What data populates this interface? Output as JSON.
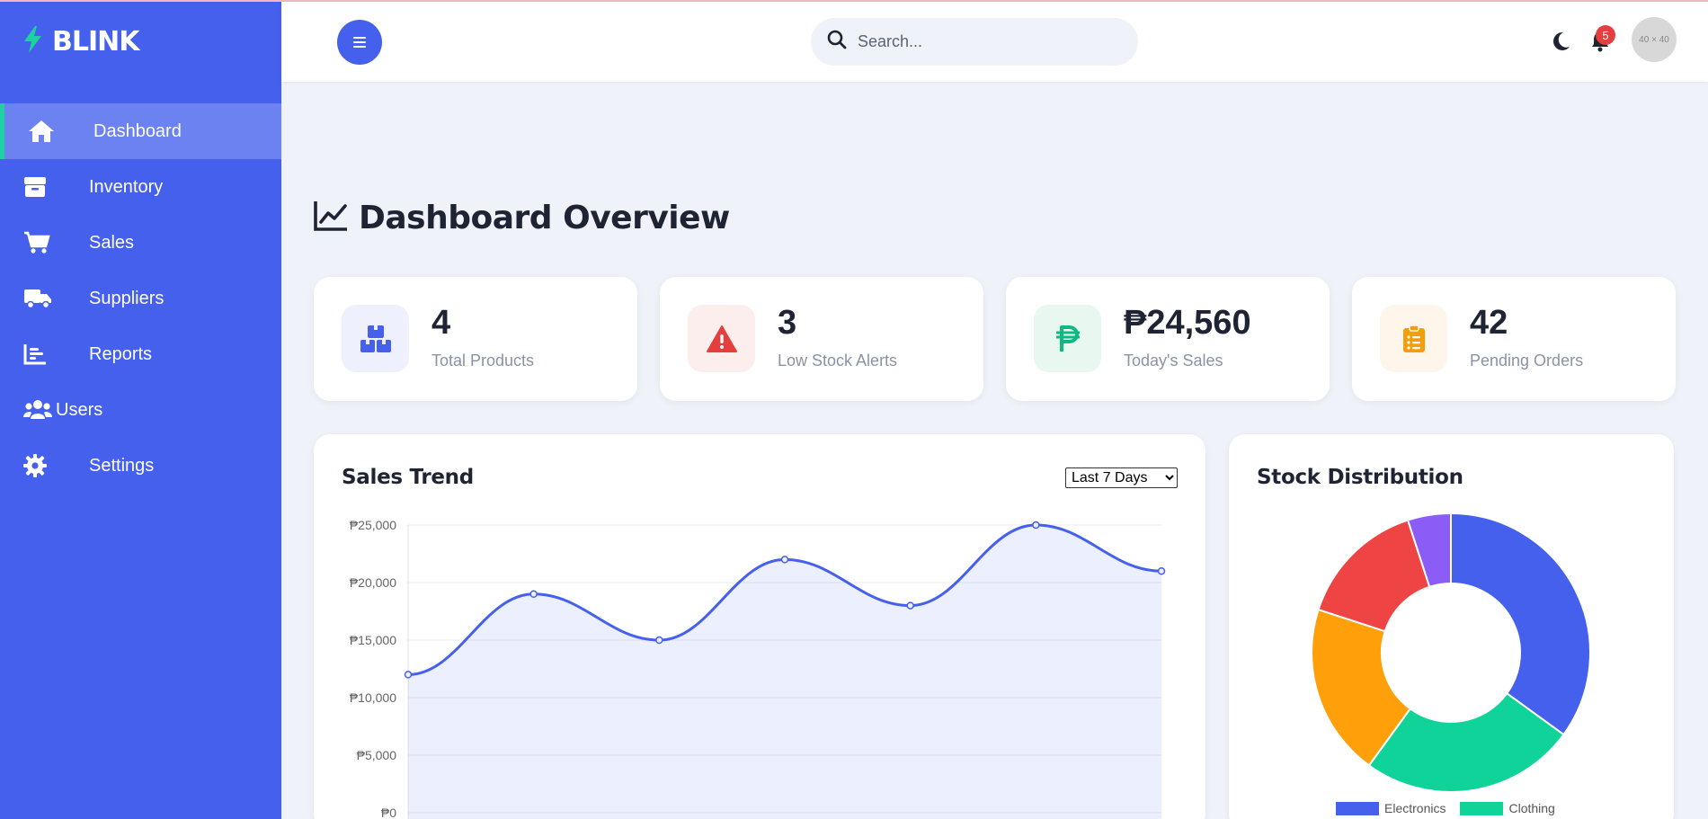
{
  "brand": {
    "name": "BLINK"
  },
  "sidebar": {
    "items": [
      {
        "label": "Dashboard",
        "icon": "home-icon",
        "active": true
      },
      {
        "label": "Inventory",
        "icon": "box-icon"
      },
      {
        "label": "Sales",
        "icon": "cart-icon"
      },
      {
        "label": "Suppliers",
        "icon": "truck-icon"
      },
      {
        "label": "Reports",
        "icon": "chart-bar-icon"
      },
      {
        "label": "Users",
        "icon": "users-icon"
      },
      {
        "label": "Settings",
        "icon": "gear-icon"
      }
    ]
  },
  "header": {
    "search_placeholder": "Search...",
    "notifications": "5",
    "avatar_text": "40 × 40"
  },
  "page": {
    "title": "Dashboard Overview"
  },
  "stats": [
    {
      "value": "4",
      "label": "Total Products",
      "icon": "boxes-icon",
      "color": "#4560ec",
      "bg": "#eef1fd"
    },
    {
      "value": "3",
      "label": "Low Stock Alerts",
      "icon": "warning-icon",
      "color": "#e53e3e",
      "bg": "#fdeeee"
    },
    {
      "value": "₱24,560",
      "label": "Today's Sales",
      "icon": "peso-icon",
      "color": "#10b981",
      "bg": "#e8f8f1"
    },
    {
      "value": "42",
      "label": "Pending Orders",
      "icon": "clipboard-icon",
      "color": "#f59e0b",
      "bg": "#fef6ea"
    }
  ],
  "sales_card": {
    "title": "Sales Trend",
    "range_selected": "Last 7 Days"
  },
  "stock_card": {
    "title": "Stock Distribution"
  },
  "colors": {
    "primary": "#4560ec",
    "accent": "#1fd1a0"
  },
  "chart_data": [
    {
      "type": "line",
      "title": "Sales Trend",
      "x": [
        "",
        "",
        "",
        "",
        "",
        "",
        ""
      ],
      "series": [
        {
          "values": [
            12000,
            19000,
            15000,
            22000,
            18000,
            25000,
            21000
          ]
        }
      ],
      "ylim": [
        0,
        25000
      ],
      "yticks": [
        "₱0",
        "₱5,000",
        "₱10,000",
        "₱15,000",
        "₱20,000",
        "₱25,000"
      ],
      "fill": true,
      "color": "#4560ec"
    },
    {
      "type": "pie",
      "title": "Stock Distribution",
      "donut": true,
      "slices": [
        {
          "label": "Electronics",
          "value": 35,
          "color": "#4560ec"
        },
        {
          "label": "Clothing",
          "value": 25,
          "color": "#10d39a"
        },
        {
          "label": "",
          "value": 20,
          "color": "#ff9f0a"
        },
        {
          "label": "",
          "value": 15,
          "color": "#ef4444"
        },
        {
          "label": "",
          "value": 5,
          "color": "#8b5cf6"
        }
      ],
      "legend_visible": [
        "Electronics",
        "Clothing"
      ]
    }
  ]
}
